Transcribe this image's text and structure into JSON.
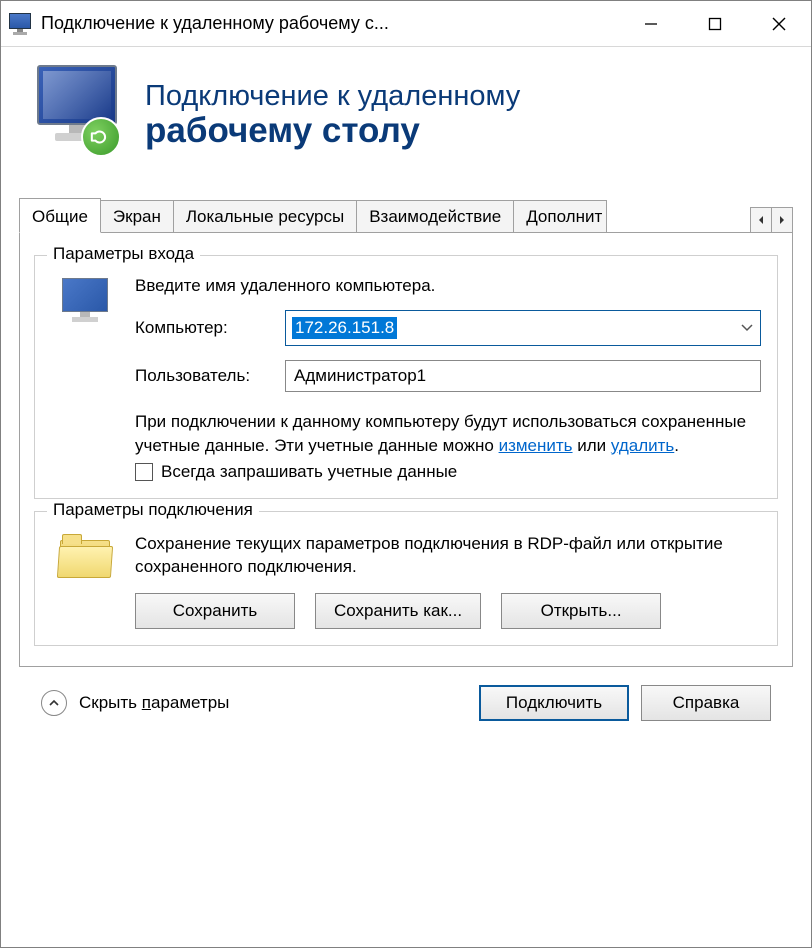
{
  "titlebar": {
    "title": "Подключение к удаленному рабочему с..."
  },
  "banner": {
    "line1": "Подключение к удаленному",
    "line2": "рабочему столу"
  },
  "tabs": {
    "items": [
      {
        "label": "Общие"
      },
      {
        "label": "Экран"
      },
      {
        "label": "Локальные ресурсы"
      },
      {
        "label": "Взаимодействие"
      },
      {
        "label": "Дополнит"
      }
    ]
  },
  "login_group": {
    "title": "Параметры входа",
    "instruction": "Введите имя удаленного компьютера.",
    "computer_label": "Компьютер:",
    "computer_value": "172.26.151.8",
    "user_label": "Пользователь:",
    "user_value": "Администратор1",
    "info_part1": "При подключении к данному компьютеру будут использоваться сохраненные учетные данные. Эти учетные данные можно ",
    "link_change": "изменить",
    "info_or": " или ",
    "link_delete": "удалить",
    "info_period": ".",
    "checkbox_label": "Всегда запрашивать учетные данные"
  },
  "conn_group": {
    "title": "Параметры подключения",
    "description": "Сохранение текущих параметров подключения в RDP-файл или открытие сохраненного подключения.",
    "save_label": "Сохранить",
    "save_as_label": "Сохранить как...",
    "open_label": "Открыть..."
  },
  "footer": {
    "collapse_prefix": "Скрыть ",
    "collapse_underlined": "п",
    "collapse_suffix": "араметры",
    "connect_label": "Подключить",
    "help_label": "Справка"
  }
}
